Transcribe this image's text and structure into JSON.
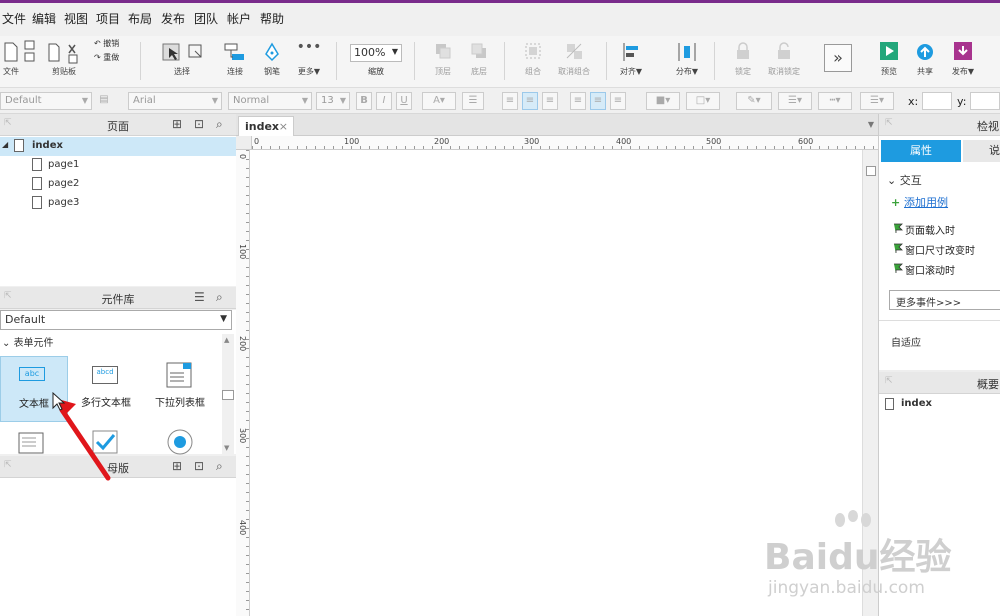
{
  "menu": [
    "文件",
    "编辑",
    "视图",
    "项目",
    "布局",
    "发布",
    "团队",
    "帐户",
    "帮助"
  ],
  "toolbar": {
    "file": "文件",
    "clipboard": "剪贴板",
    "undo": "撤销",
    "redo": "重做",
    "select": "选择",
    "connect": "连接",
    "pen": "钢笔",
    "more": "更多▼",
    "zoom_value": "100%",
    "zoom_label": "缩放",
    "top": "顶层",
    "bottom": "底层",
    "group": "组合",
    "ungroup": "取消组合",
    "align": "对齐▼",
    "distribute": "分布▼",
    "lock": "锁定",
    "unlock": "取消锁定",
    "preview": "预览",
    "share": "共享",
    "publish": "发布▼"
  },
  "format": {
    "style": "Default",
    "font": "Arial",
    "weight": "Normal",
    "size": "13",
    "bold": "B",
    "italic": "I",
    "underline": "U",
    "x_label": "x:",
    "y_label": "y:"
  },
  "pages_panel": {
    "title": "页面",
    "root": "index",
    "children": [
      "page1",
      "page2",
      "page3"
    ]
  },
  "library_panel": {
    "title": "元件库",
    "selected": "Default",
    "section": "表单元件",
    "widgets": [
      "文本框",
      "多行文本框",
      "下拉列表框"
    ],
    "widget_icon_text": [
      "abc",
      "abcd"
    ]
  },
  "master_panel": {
    "title": "母版"
  },
  "canvas": {
    "tab": "index",
    "ruler_top": [
      "0",
      "100",
      "200",
      "300",
      "400",
      "500",
      "600"
    ],
    "ruler_left": [
      "0",
      "100",
      "200",
      "300",
      "400"
    ]
  },
  "inspector": {
    "title": "检视:",
    "tab_props": "属性",
    "tab_notes": "说",
    "section": "交互",
    "add_case": "添加用例",
    "events": [
      "页面载入时",
      "窗口尺寸改变时",
      "窗口滚动时"
    ],
    "more_events": "更多事件>>>",
    "adaptive": "自适应"
  },
  "outline": {
    "title": "概要:",
    "item": "index"
  },
  "watermark": {
    "brand": "Baidu经验",
    "url": "jingyan.baidu.com"
  },
  "colors": {
    "accent_blue": "#1e9be0",
    "selection": "#cde8f8",
    "arrow": "#e0161b",
    "title_purple": "#7a2c8c"
  }
}
